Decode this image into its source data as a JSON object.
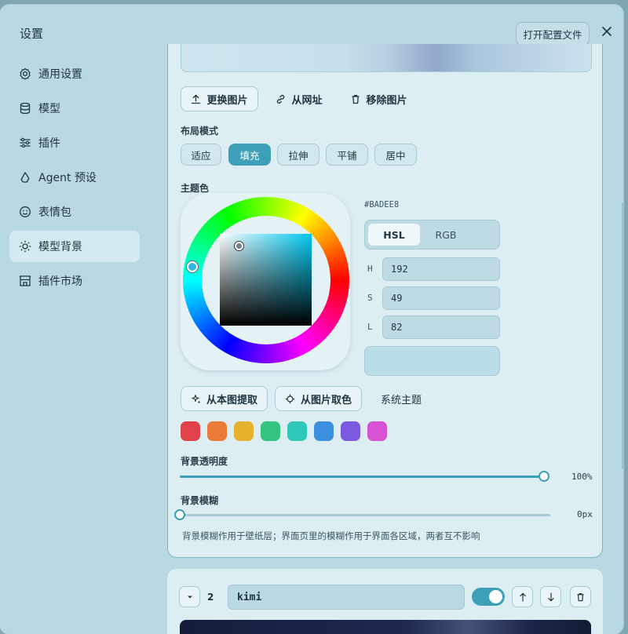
{
  "window": {
    "title": "设置",
    "open_config_label": "打开配置文件"
  },
  "sidebar": {
    "items": [
      {
        "label": "通用设置",
        "icon": "gear-icon"
      },
      {
        "label": "模型",
        "icon": "database-icon"
      },
      {
        "label": "插件",
        "icon": "sliders-icon"
      },
      {
        "label": "Agent 预设",
        "icon": "recycle-icon"
      },
      {
        "label": "表情包",
        "icon": "smiley-icon"
      },
      {
        "label": "模型背景",
        "icon": "sun-icon",
        "active": true
      },
      {
        "label": "插件市场",
        "icon": "store-icon"
      }
    ]
  },
  "image_actions": {
    "replace": "更换图片",
    "from_url": "从网址",
    "remove": "移除图片"
  },
  "layout": {
    "label": "布局模式",
    "options": [
      "适应",
      "填充",
      "拉伸",
      "平铺",
      "居中"
    ],
    "selected": "填充"
  },
  "theme": {
    "label": "主题色",
    "hex": "#BADEE8",
    "modes": [
      "HSL",
      "RGB"
    ],
    "active_mode": "HSL",
    "fields": [
      {
        "label": "H",
        "value": "192"
      },
      {
        "label": "S",
        "value": "49"
      },
      {
        "label": "L",
        "value": "82"
      }
    ],
    "extract_from_image": "从本图提取",
    "pick_from_image": "从图片取色",
    "system_theme": "系统主题",
    "swatches": [
      "#e0414a",
      "#ea7a36",
      "#e6b22e",
      "#33c47f",
      "#2fc7b8",
      "#3d8fe0",
      "#7c5ae0",
      "#d752d4"
    ]
  },
  "opacity": {
    "label": "背景透明度",
    "value_text": "100%",
    "fraction": 1.0
  },
  "blur": {
    "label": "背景模糊",
    "value_text": "0px",
    "fraction": 0.0
  },
  "note": "背景模糊作用于壁纸层；界面页里的模糊作用于界面各区域，两者互不影响",
  "entry2": {
    "index": "2",
    "name": "kimi",
    "enabled": true
  }
}
